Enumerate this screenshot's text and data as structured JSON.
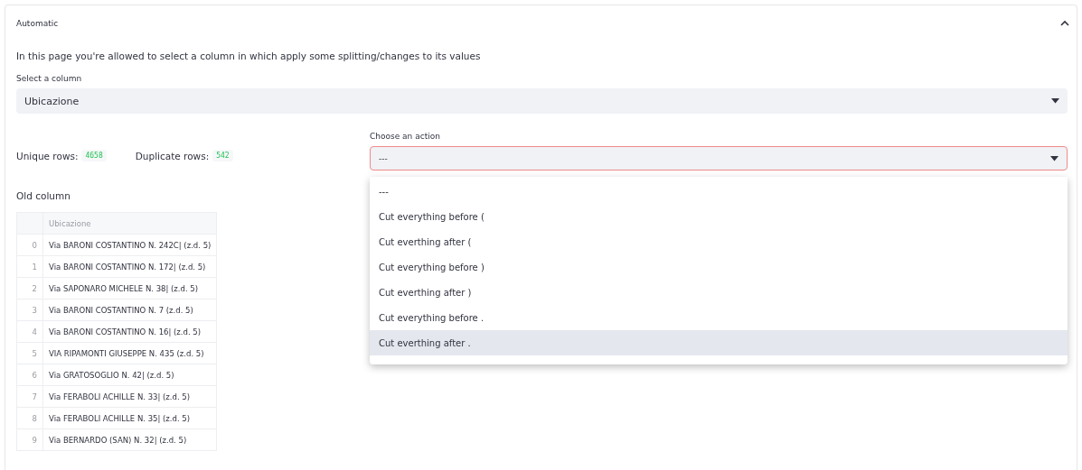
{
  "expander": {
    "title": "Automatic",
    "expanded": true
  },
  "intro": "In this page you're allowed to select a column in which apply some splitting/changes to its values",
  "column_select": {
    "label": "Select a column",
    "value": "Ubicazione"
  },
  "stats": [
    {
      "label": "Unique rows:",
      "value": "4658"
    },
    {
      "label": "Duplicate rows:",
      "value": "542"
    }
  ],
  "action_select": {
    "label": "Choose an action",
    "value": "---",
    "open": true,
    "options": [
      {
        "label": "---",
        "highlighted": false
      },
      {
        "label": "Cut everything before (",
        "highlighted": false
      },
      {
        "label": "Cut everthing after (",
        "highlighted": false
      },
      {
        "label": "Cut everything before )",
        "highlighted": false
      },
      {
        "label": "Cut everthing after )",
        "highlighted": false
      },
      {
        "label": "Cut everything before .",
        "highlighted": false
      },
      {
        "label": "Cut everthing after .",
        "highlighted": true
      }
    ]
  },
  "old_column": {
    "title": "Old column",
    "columns": [
      "Ubicazione"
    ],
    "rows": [
      {
        "index": "0",
        "value": "Via BARONI COSTANTINO N. 242C| (z.d. 5)"
      },
      {
        "index": "1",
        "value": "Via BARONI COSTANTINO N. 172| (z.d. 5)"
      },
      {
        "index": "2",
        "value": "Via SAPONARO MICHELE N. 38| (z.d. 5)"
      },
      {
        "index": "3",
        "value": "Via BARONI COSTANTINO N. 7 (z.d. 5)"
      },
      {
        "index": "4",
        "value": "Via BARONI COSTANTINO N. 16| (z.d. 5)"
      },
      {
        "index": "5",
        "value": "VIA RIPAMONTI GIUSEPPE N. 435 (z.d. 5)"
      },
      {
        "index": "6",
        "value": "Via GRATOSOGLIO N. 42| (z.d. 5)"
      },
      {
        "index": "7",
        "value": "Via FERABOLI ACHILLE N. 33| (z.d. 5)"
      },
      {
        "index": "8",
        "value": "Via FERABOLI ACHILLE N. 35| (z.d. 5)"
      },
      {
        "index": "9",
        "value": "Via BERNARDO (SAN) N. 32| (z.d. 5)"
      }
    ]
  }
}
